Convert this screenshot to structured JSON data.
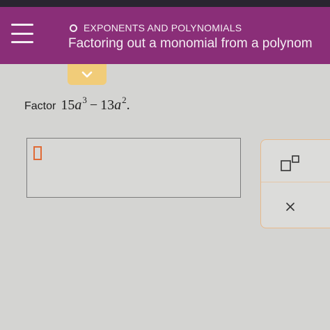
{
  "header": {
    "topic": "EXPONENTS AND POLYNOMIALS",
    "title": "Factoring out a monomial from a polynom"
  },
  "problem": {
    "prefix": "Factor",
    "term1_coef": "15",
    "term1_var": "a",
    "term1_exp": "3",
    "operator": "−",
    "term2_coef": "13",
    "term2_var": "a",
    "term2_exp": "2",
    "end": "."
  },
  "icons": {
    "menu": "hamburger-menu-icon",
    "collapse": "chevron-down-icon",
    "exponent": "exponent-template-icon",
    "clear": "close-icon"
  },
  "colors": {
    "header": "#8a2e78",
    "tab": "#f1cc79",
    "cursor": "#e06a35",
    "panel_border": "#e8b98a"
  }
}
